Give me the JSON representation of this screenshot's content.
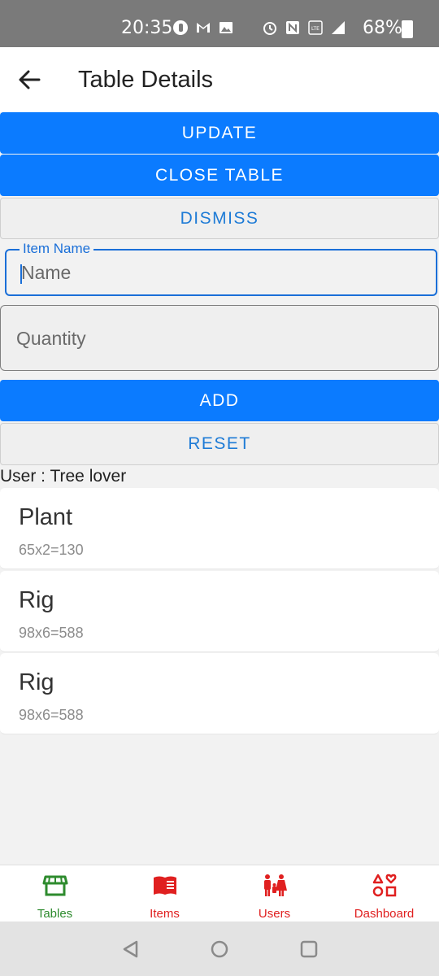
{
  "status_bar": {
    "time": "20:35",
    "battery": "68%",
    "icons": [
      "opera-icon",
      "gmail-icon",
      "gallery-icon",
      "alarm-icon",
      "nfc-icon",
      "volte-icon",
      "signal-icon",
      "battery-icon"
    ]
  },
  "app_bar": {
    "title": "Table Details"
  },
  "actions": {
    "update": "UPDATE",
    "close_table": "CLOSE TABLE",
    "dismiss": "DISMISS",
    "add": "ADD",
    "reset": "RESET"
  },
  "form": {
    "item_name_label": "Item Name",
    "item_name_placeholder": "Name",
    "quantity_placeholder": "Quantity"
  },
  "user_label": "User : Tree lover",
  "items": [
    {
      "name": "Plant",
      "calc": "65x2=130"
    },
    {
      "name": "Rig",
      "calc": "98x6=588"
    },
    {
      "name": "Rig",
      "calc": "98x6=588"
    }
  ],
  "bottom_nav": [
    {
      "label": "Tables",
      "icon": "store-icon",
      "color": "#2e8b2e",
      "active": true
    },
    {
      "label": "Items",
      "icon": "menu-book-icon",
      "color": "#e02020",
      "active": false
    },
    {
      "label": "Users",
      "icon": "family-icon",
      "color": "#e02020",
      "active": false
    },
    {
      "label": "Dashboard",
      "icon": "shapes-icon",
      "color": "#e02020",
      "active": false
    }
  ],
  "colors": {
    "primary": "#0b7bff",
    "secondary_text": "#1e7bd6",
    "active_nav": "#2e8b2e",
    "inactive_nav": "#e02020"
  }
}
